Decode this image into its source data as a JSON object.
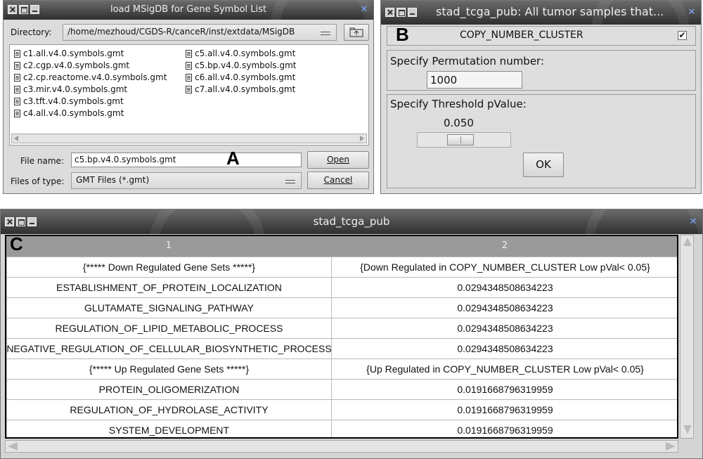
{
  "panel_a": {
    "label": "A",
    "title": "load MSigDB for Gene Symbol List",
    "directory_label": "Directory:",
    "directory_value": "/home/mezhoud/CGDS-R/canceR/inst/extdata/MSigDB",
    "files_col1": [
      "c1.all.v4.0.symbols.gmt",
      "c2.cgp.v4.0.symbols.gmt",
      "c2.cp.reactome.v4.0.symbols.gmt",
      "c3.mir.v4.0.symbols.gmt",
      "c3.tft.v4.0.symbols.gmt",
      "c4.all.v4.0.symbols.gmt"
    ],
    "files_col2": [
      "c5.all.v4.0.symbols.gmt",
      "c5.bp.v4.0.symbols.gmt",
      "c6.all.v4.0.symbols.gmt",
      "c7.all.v4.0.symbols.gmt"
    ],
    "file_name_label": "File name:",
    "file_name_value": "c5.bp.v4.0.symbols.gmt",
    "files_type_label": "Files of type:",
    "files_type_value": "GMT Files (*.gmt)",
    "open_label": "Open",
    "cancel_label": "Cancel"
  },
  "panel_b": {
    "label": "B",
    "title": "stad_tcga_pub: All tumor samples that...",
    "checkbox_label": "COPY_NUMBER_CLUSTER",
    "checkbox_checked": true,
    "permutation_label": "Specify Permutation number:",
    "permutation_value": "1000",
    "threshold_label": "Specify Threshold pValue:",
    "threshold_value": "0.050",
    "ok_label": "OK"
  },
  "panel_c": {
    "label": "C",
    "title": "stad_tcga_pub",
    "columns": [
      "1",
      "2"
    ],
    "rows": [
      [
        "{***** Down Regulated Gene Sets *****}",
        "{Down Regulated in COPY_NUMBER_CLUSTER Low pVal< 0.05}"
      ],
      [
        "ESTABLISHMENT_OF_PROTEIN_LOCALIZATION",
        "0.0294348508634223"
      ],
      [
        "GLUTAMATE_SIGNALING_PATHWAY",
        "0.0294348508634223"
      ],
      [
        "REGULATION_OF_LIPID_METABOLIC_PROCESS",
        "0.0294348508634223"
      ],
      [
        "NEGATIVE_REGULATION_OF_CELLULAR_BIOSYNTHETIC_PROCESS",
        "0.0294348508634223"
      ],
      [
        "{***** Up Regulated Gene Sets *****}",
        "{Up Regulated in COPY_NUMBER_CLUSTER Low pVal< 0.05}"
      ],
      [
        "PROTEIN_OLIGOMERIZATION",
        "0.0191668796319959"
      ],
      [
        "REGULATION_OF_HYDROLASE_ACTIVITY",
        "0.0191668796319959"
      ],
      [
        "SYSTEM_DEVELOPMENT",
        "0.0191668796319959"
      ]
    ]
  }
}
